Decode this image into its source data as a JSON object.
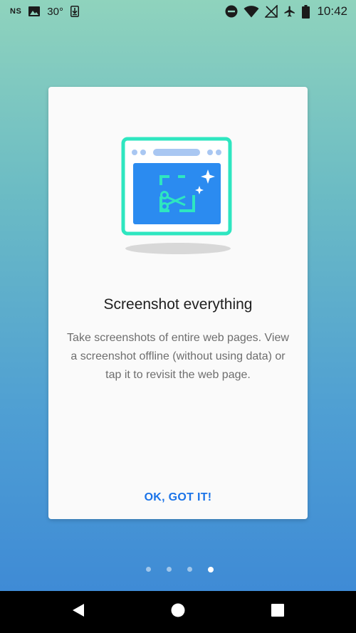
{
  "status_bar": {
    "carrier_label": "NS",
    "temperature": "30°",
    "time": "10:42",
    "icons_left": [
      "image-icon",
      "download-icon"
    ],
    "icons_right": [
      "do-not-disturb-icon",
      "wifi-icon",
      "no-signal-icon",
      "airplane-icon",
      "battery-icon"
    ]
  },
  "promo_card": {
    "title": "Screenshot everything",
    "body": "Take screenshots of entire web pages. View a screenshot offline (without using data) or tap it to revisit the web page.",
    "button_label": "OK, GOT IT!"
  },
  "pager": {
    "total": 4,
    "active_index": 3
  },
  "colors": {
    "accent": "#1a73e8",
    "illustration_frame": "#2ee6c0",
    "illustration_screen": "#2b8bf0",
    "illustration_bar": "#a9c7f2"
  },
  "nav_bar": {
    "icons": [
      "back-icon",
      "home-icon",
      "recents-icon"
    ]
  }
}
